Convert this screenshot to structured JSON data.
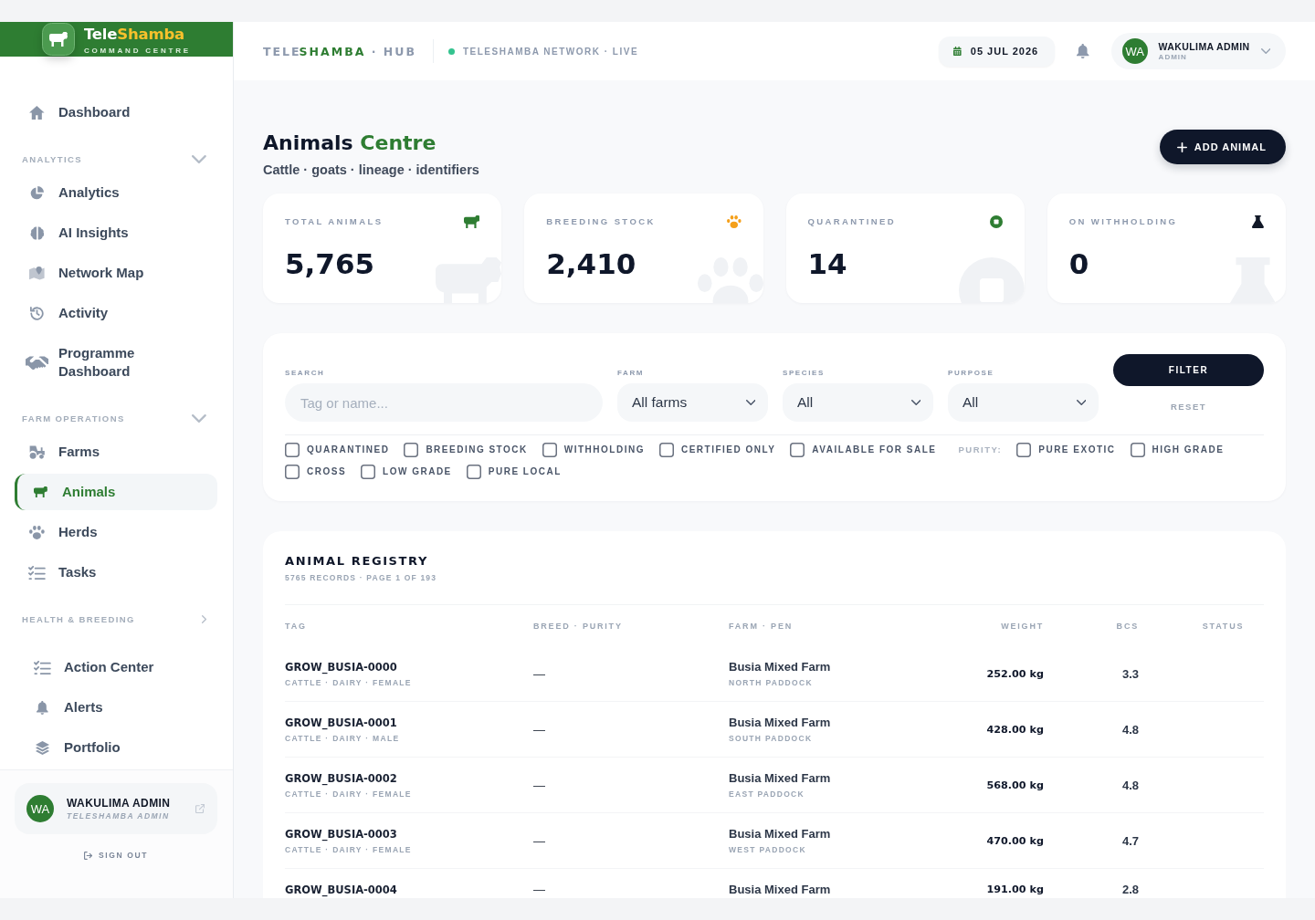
{
  "sidebar": {
    "logo": {
      "title": "Tele",
      "title_highlight": "Shamba",
      "tagline": "COMMAND CENTRE"
    },
    "home": {
      "label": "Dashboard",
      "selected": false
    },
    "sections": [
      {
        "title": "ANALYTICS",
        "expanded": true,
        "items": [
          {
            "label": "Analytics",
            "selected": false
          },
          {
            "label": "AI Insights",
            "selected": false
          },
          {
            "label": "Network Map",
            "selected": false
          },
          {
            "label": "Activity",
            "selected": false
          },
          {
            "label": "Programme Dashboard",
            "selected": false
          }
        ]
      },
      {
        "title": "FARM OPERATIONS",
        "expanded": true,
        "items": [
          {
            "label": "Farms",
            "selected": false
          },
          {
            "label": "Animals",
            "selected": true
          },
          {
            "label": "Herds",
            "selected": false
          },
          {
            "label": "Tasks",
            "selected": false
          }
        ]
      },
      {
        "title": "HEALTH & BREEDING",
        "expanded": false
      }
    ],
    "links": [
      {
        "label": "Action Center",
        "selected": false
      },
      {
        "label": "Alerts",
        "selected": false
      },
      {
        "label": "Portfolio",
        "selected": false
      }
    ],
    "user": {
      "initials": "WA",
      "name": "WAKULIMA ADMIN",
      "role": "TELESHAMBA ADMIN"
    },
    "sign_out": "SIGN OUT"
  },
  "topbar": {
    "brand": {
      "prefix": "TELE",
      "highlight": "SHAMBA",
      "suffix": "· HUB"
    },
    "network_status": "TELESHAMBA NETWORK · LIVE",
    "date": "05 JUL 2026",
    "user": {
      "initials": "WA",
      "name": "WAKULIMA ADMIN",
      "role": "ADMIN"
    }
  },
  "page_header": {
    "title": "Animals",
    "title_highlight": "Centre",
    "subtitle": "Cattle · goats · lineage · identifiers",
    "add_button": "ADD ANIMAL"
  },
  "stats": [
    {
      "label": "TOTAL ANIMALS",
      "value": "5,765"
    },
    {
      "label": "BREEDING STOCK",
      "value": "2,410"
    },
    {
      "label": "QUARANTINED",
      "value": "14"
    },
    {
      "label": "ON WITHHOLDING",
      "value": "0"
    }
  ],
  "filters": {
    "search": {
      "label": "SEARCH",
      "placeholder": "Tag or name..."
    },
    "selects": [
      {
        "label": "FARM",
        "value": "All farms"
      },
      {
        "label": "SPECIES",
        "value": "All"
      },
      {
        "label": "PURPOSE",
        "value": "All"
      }
    ],
    "filter_button": "FILTER",
    "reset_button": "RESET",
    "flags": [
      {
        "label": "QUARANTINED",
        "checked": false
      },
      {
        "label": "BREEDING STOCK",
        "checked": false
      },
      {
        "label": "WITHHOLDING",
        "checked": false
      },
      {
        "label": "CERTIFIED ONLY",
        "checked": false
      },
      {
        "label": "AVAILABLE FOR SALE",
        "checked": false
      }
    ],
    "purity": {
      "label": "PURITY:",
      "options": [
        {
          "label": "PURE EXOTIC",
          "checked": false
        },
        {
          "label": "HIGH GRADE",
          "checked": false
        },
        {
          "label": "CROSS",
          "checked": false
        },
        {
          "label": "LOW GRADE",
          "checked": false
        },
        {
          "label": "PURE LOCAL",
          "checked": false
        }
      ]
    }
  },
  "registry": {
    "title": "ANIMAL REGISTRY",
    "subtitle": "5765 RECORDS · PAGE 1 OF 193",
    "columns": [
      "TAG",
      "BREED · PURITY",
      "FARM · PEN",
      "WEIGHT",
      "BCS",
      "STATUS"
    ],
    "rows": [
      {
        "tag": "GROW_BUSIA-0000",
        "details": "CATTLE · DAIRY · FEMALE",
        "breed": "—",
        "farm": "Busia Mixed Farm",
        "pen": "NORTH PADDOCK",
        "weight": "252.00 kg",
        "bcs": "3.3"
      },
      {
        "tag": "GROW_BUSIA-0001",
        "details": "CATTLE · DAIRY · MALE",
        "breed": "—",
        "farm": "Busia Mixed Farm",
        "pen": "SOUTH PADDOCK",
        "weight": "428.00 kg",
        "bcs": "4.8"
      },
      {
        "tag": "GROW_BUSIA-0002",
        "details": "CATTLE · DAIRY · FEMALE",
        "breed": "—",
        "farm": "Busia Mixed Farm",
        "pen": "EAST PADDOCK",
        "weight": "568.00 kg",
        "bcs": "4.8"
      },
      {
        "tag": "GROW_BUSIA-0003",
        "details": "CATTLE · DAIRY · FEMALE",
        "breed": "—",
        "farm": "Busia Mixed Farm",
        "pen": "WEST PADDOCK",
        "weight": "470.00 kg",
        "bcs": "4.7"
      },
      {
        "tag": "GROW_BUSIA-0004",
        "breed": "—",
        "farm": "Busia Mixed Farm",
        "weight": "191.00 kg",
        "bcs": "2.8"
      }
    ]
  }
}
